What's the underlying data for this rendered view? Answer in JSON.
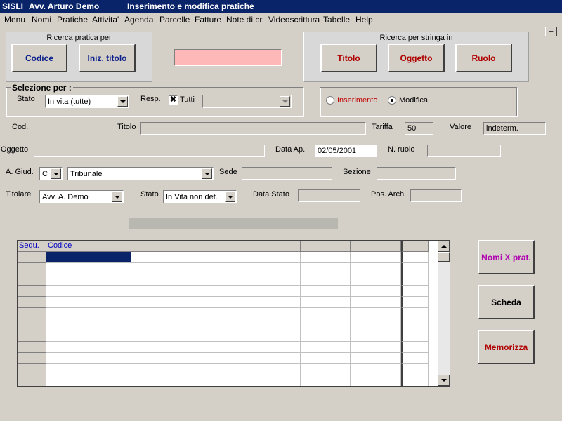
{
  "titlebar": {
    "app": "SISLI",
    "user": "Avv.  Arturo Demo",
    "window": "Inserimento e modifica pratiche"
  },
  "menu": [
    "Menu",
    "Nomi",
    "Pratiche",
    "Attivita'",
    "Agenda",
    "Parcelle",
    "Fatture",
    "Note di cr.",
    "Videoscrittura",
    "Tabelle",
    "Help"
  ],
  "minimize_label": "–",
  "ricerca_pratica": {
    "title": "Ricerca pratica per",
    "codice": "Codice",
    "iniz_titolo": "Iniz. titolo"
  },
  "search_value": "",
  "ricerca_stringa": {
    "title": "Ricerca per stringa in",
    "titolo": "Titolo",
    "oggetto": "Oggetto",
    "ruolo": "Ruolo"
  },
  "selezione": {
    "title": "Selezione per :",
    "stato_label": "Stato",
    "stato_value": "In vita (tutte)",
    "resp_label": "Resp.",
    "tutti_label": "Tutti",
    "tutti_mark": "✖",
    "resp_value": ""
  },
  "mode": {
    "inserimento": "Inserimento",
    "modifica": "Modifica",
    "selected": "modifica"
  },
  "form": {
    "cod_label": "Cod.",
    "titolo_label": "Titolo",
    "tariffa_label": "Tariffa",
    "tariffa_value": "50",
    "valore_label": "Valore",
    "valore_value": "indeterm.",
    "oggetto_label": "Oggetto",
    "data_ap_label": "Data Ap.",
    "data_ap_value": "02/05/2001",
    "n_ruolo_label": "N.  ruolo",
    "a_giud_label": "A. Giud.",
    "a_giud_code": "C",
    "a_giud_value": "Tribunale",
    "sede_label": "Sede",
    "sezione_label": "Sezione",
    "titolare_label": "Titolare",
    "titolare_value": "Avv. A. Demo",
    "stato_label": "Stato",
    "stato_value": "In Vita non def.",
    "data_stato_label": "Data  Stato",
    "pos_arch_label": "Pos. Arch."
  },
  "grid": {
    "headers": [
      "Sequ.",
      "Codice",
      "",
      "",
      "",
      ""
    ]
  },
  "side_buttons": {
    "nomi": "Nomi X prat.",
    "scheda": "Scheda",
    "memorizza": "Memorizza"
  },
  "colors": {
    "titlebar": "#0a246a",
    "pink_input": "#ffb8b8",
    "selection": "#0a246a"
  }
}
